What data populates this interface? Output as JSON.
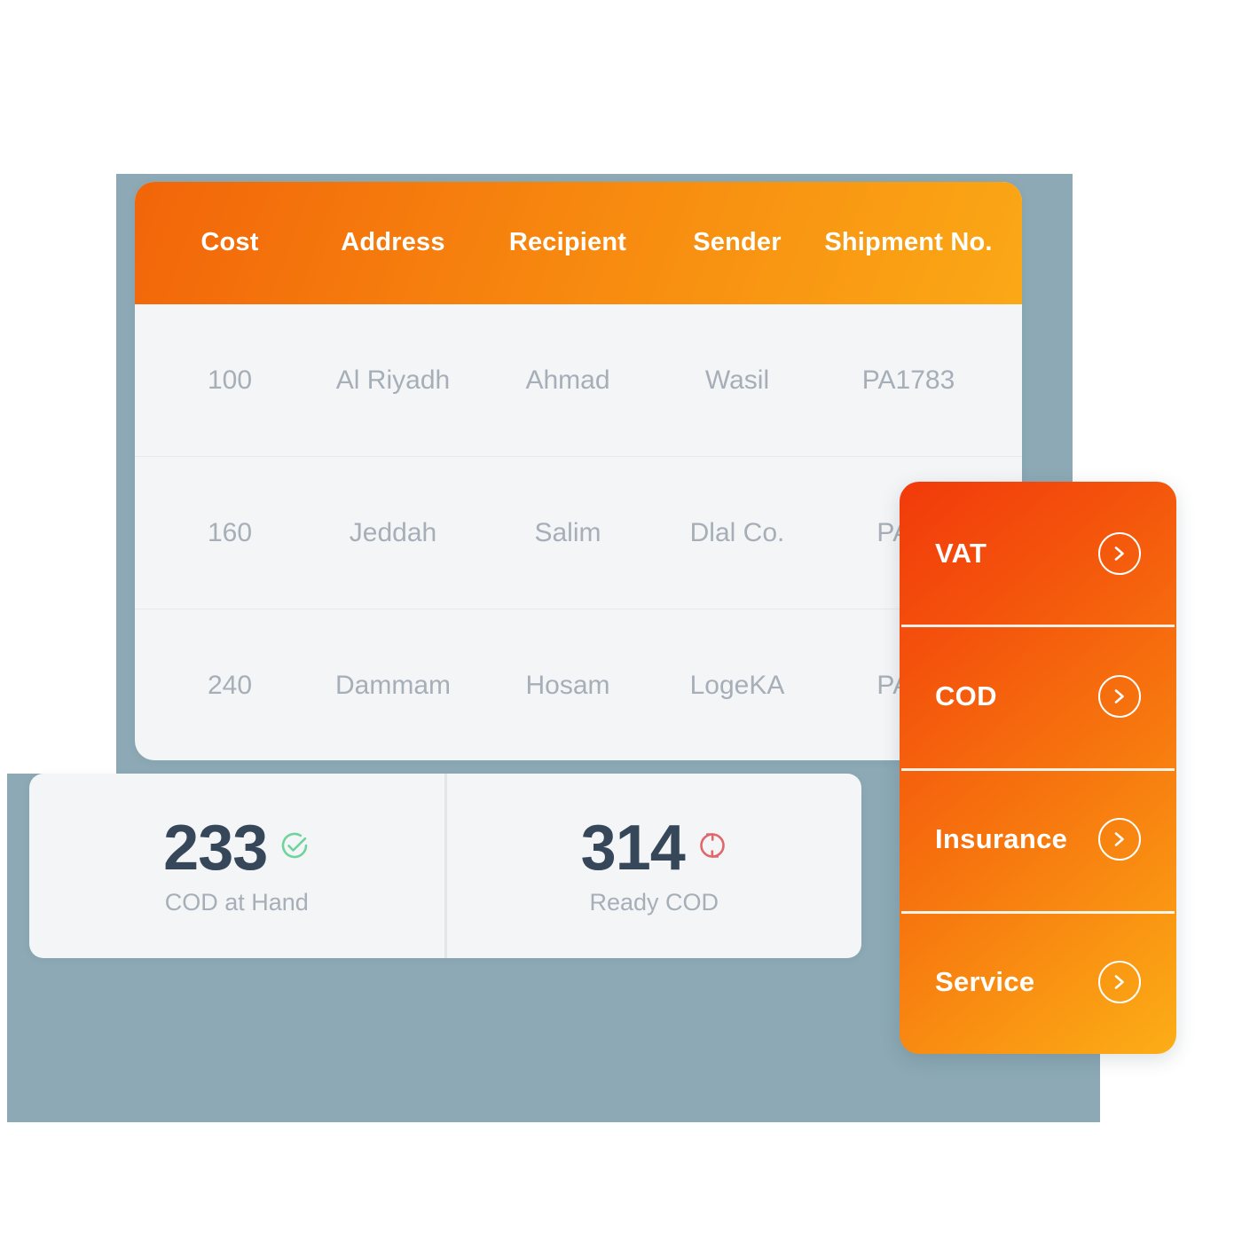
{
  "theme": {
    "backdrop_slate": "#8CA9B5",
    "card_bg": "#F4F5F7",
    "header_gradient_from": "#F2650A",
    "header_gradient_to": "#FBA816",
    "menu_gradient_from": "#F23A0B",
    "menu_gradient_to": "#FCAE17",
    "muted_text": "#A6AEB8",
    "value_text": "#37475A",
    "success_green": "#6FD49C",
    "alert_red": "#E0676B"
  },
  "table": {
    "columns": [
      "Cost",
      "Address",
      "Recipient",
      "Sender",
      "Shipment No."
    ],
    "rows": [
      {
        "cost": "100",
        "address": "Al Riyadh",
        "recipient": "Ahmad",
        "sender": "Wasil",
        "shipment_no": "PA1783"
      },
      {
        "cost": "160",
        "address": "Jeddah",
        "recipient": "Salim",
        "sender": "Dlal Co.",
        "shipment_no": "PA25"
      },
      {
        "cost": "240",
        "address": "Dammam",
        "recipient": "Hosam",
        "sender": "LogeKA",
        "shipment_no": "PA31"
      }
    ]
  },
  "stats": [
    {
      "value": "233",
      "label": "COD at Hand",
      "icon": "check-circle-icon",
      "icon_color": "#6FD49C"
    },
    {
      "value": "314",
      "label": "Ready COD",
      "icon": "refresh-circle-icon",
      "icon_color": "#E0676B"
    }
  ],
  "side_menu": {
    "items": [
      {
        "label": "VAT",
        "arrow_icon": "chevron-right-icon"
      },
      {
        "label": "COD",
        "arrow_icon": "chevron-right-icon"
      },
      {
        "label": "Insurance",
        "arrow_icon": "chevron-right-icon"
      },
      {
        "label": "Service",
        "arrow_icon": "chevron-right-icon"
      }
    ]
  }
}
